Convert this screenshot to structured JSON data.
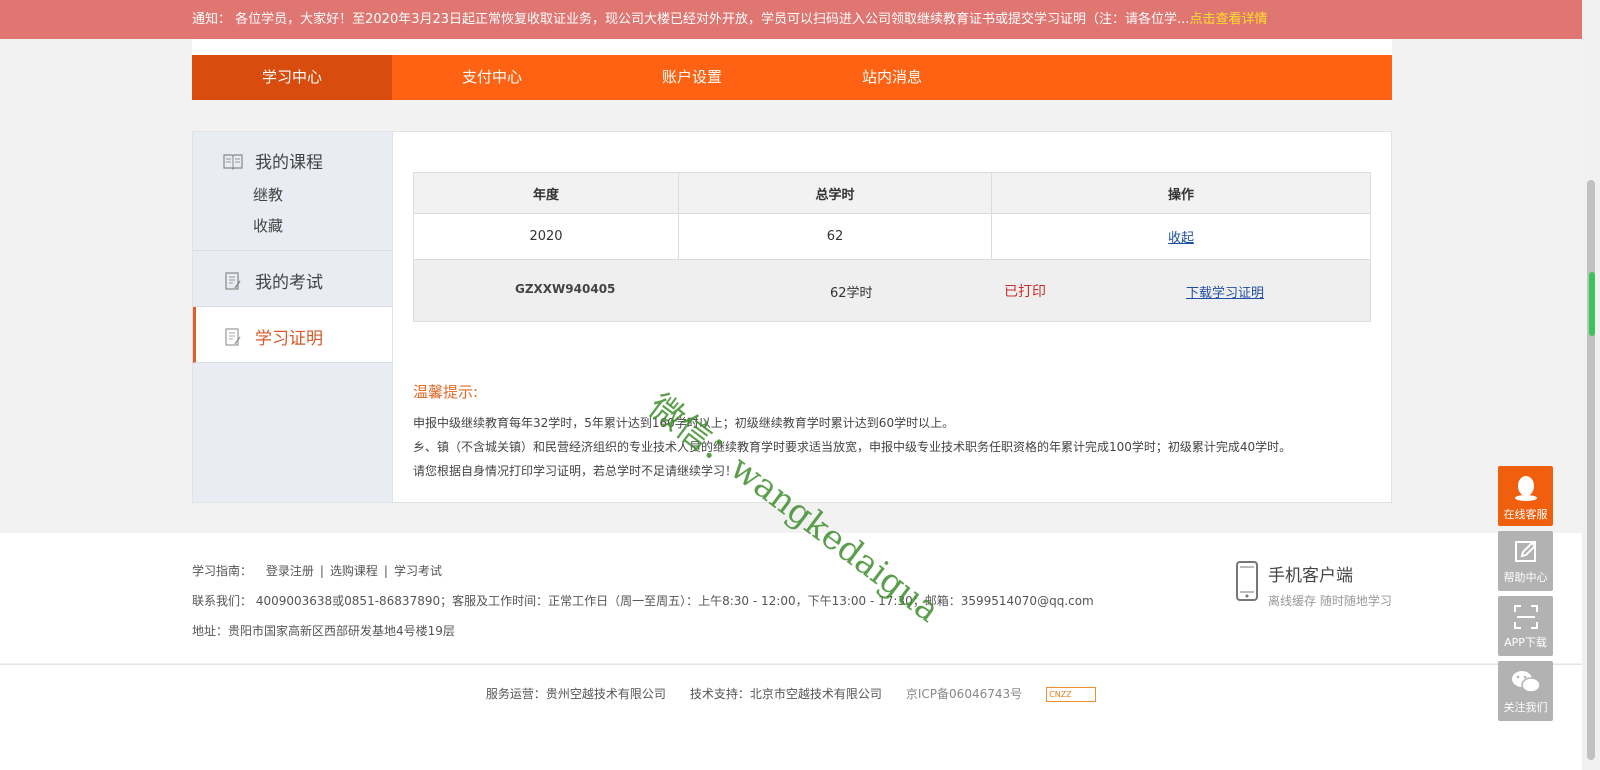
{
  "notice": {
    "text": "通知：  各位学员，大家好！至2020年3月23日起正常恢复收取证业务，现公司大楼已经对外开放，学员可以扫码进入公司领取继续教育证书或提交学习证明（注：请各位学...",
    "link": "点击查看详情"
  },
  "nav": {
    "items": [
      "学习中心",
      "支付中心",
      "账户设置",
      "站内消息"
    ]
  },
  "sidebar": {
    "courses_title": "我的课程",
    "courses_sub1": "继教",
    "courses_sub2": "收藏",
    "exam_title": "我的考试",
    "cert_title": "学习证明"
  },
  "table": {
    "headers": [
      "年度",
      "总学时",
      "操作"
    ],
    "row": {
      "year": "2020",
      "hours": "62",
      "action": "收起"
    },
    "detail": {
      "code": "GZXXW940405",
      "hours": "62学时",
      "status": "已打印",
      "download": "下载学习证明"
    }
  },
  "tips": {
    "title": "温馨提示:",
    "line1": "申报中级继续教育每年32学时，5年累计达到160学时以上；初级继续教育学时累计达到60学时以上。",
    "line2": "乡、镇（不含城关镇）和民营经济组织的专业技术人员的继续教育学时要求适当放宽，申报中级专业技术职务任职资格的年累计完成100学时；初级累计完成40学时。",
    "line3": "请您根据自身情况打印学习证明，若总学时不足请继续学习！"
  },
  "watermark": "微信：wangkedaigua",
  "footer": {
    "guide_label": "学习指南：",
    "guide_links": [
      "登录注册",
      "选购课程",
      "学习考试"
    ],
    "contact": "联系我们：  4009003638或0851-86837890；客服及工作时间：正常工作日（周一至周五）：上午8:30 - 12:00，下午13:00 - 17:30；邮箱：3599514070@qq.com",
    "address": "地址：贵阳市国家高新区西部研发基地4号楼19层",
    "mobile_title": "手机客户端",
    "mobile_sub": "离线缓存 随时随地学习"
  },
  "copyright": {
    "operator": "服务运营：贵州空越技术有限公司",
    "support": "技术支持：北京市空越技术有限公司",
    "icp": "京ICP备06046743号",
    "cnzz": "CNZZ"
  },
  "float_buttons": [
    "在线客服",
    "帮助中心",
    "APP下载",
    "关注我们"
  ],
  "colors": {
    "nav_orange": "#fe6212",
    "nav_active": "#d84d0e",
    "notice_bg": "#e07672",
    "accent": "#e25f2a",
    "link": "#1e50a2"
  }
}
